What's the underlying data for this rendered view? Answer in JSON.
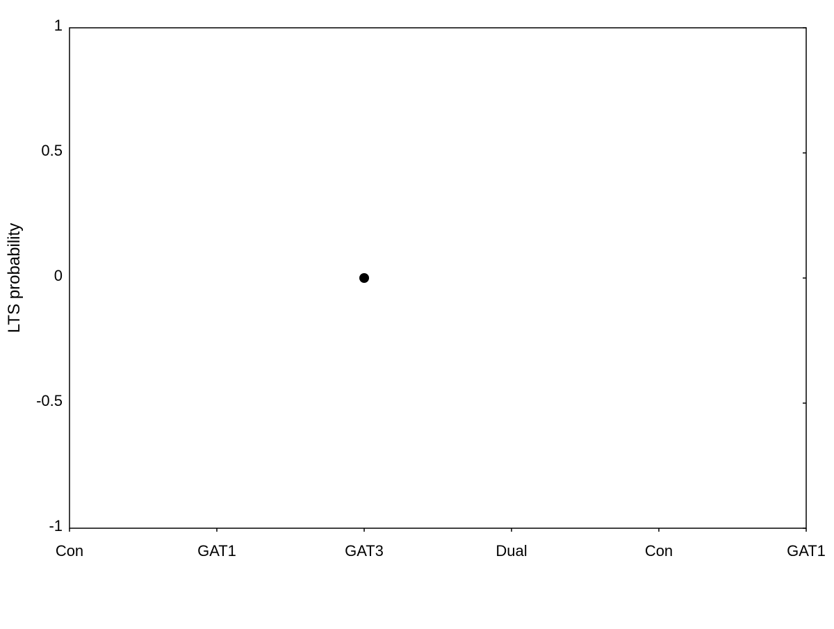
{
  "chart": {
    "title": "",
    "y_axis_label": "LTS probability",
    "x_axis_labels": [
      "Con",
      "GAT1",
      "GAT3",
      "Dual",
      "Con",
      "GAT1"
    ],
    "y_axis_ticks": [
      "1",
      "0.5",
      "0",
      "-0.5",
      "-1"
    ],
    "y_range": [
      -1,
      1
    ],
    "x_range": [
      0,
      5
    ],
    "data_point": {
      "x_label": "GAT3",
      "x_index": 2,
      "y_value": 0.0
    },
    "colors": {
      "axis": "#000000",
      "grid_tick": "#000000",
      "data_point": "#000000",
      "background": "#ffffff"
    }
  }
}
